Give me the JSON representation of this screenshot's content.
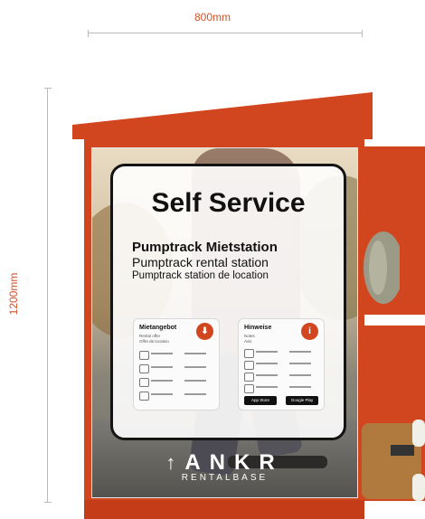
{
  "dimensions": {
    "width_label": "800mm",
    "height_label": "1200mm"
  },
  "sign": {
    "title": "Self Service",
    "subtitle_de": "Pumptrack Mietstation",
    "subtitle_en": "Pumptrack rental station",
    "subtitle_fr": "Pumptrack station de location",
    "rental_card": {
      "heading": "Mietangebot",
      "sub1": "Rental offer",
      "sub2": "Offre de location",
      "badge_icon": "pin-icon"
    },
    "info_card": {
      "heading": "Hinweise",
      "sub1": "Notes",
      "sub2": "Avis",
      "badge_icon": "info-icon",
      "store_apple": "App Store",
      "store_google": "Google Play"
    }
  },
  "logo": {
    "arrow": "↑",
    "name": "ANKR",
    "tagline": "RENTALBASE"
  },
  "colors": {
    "cabinet": "#d2461f",
    "dimension_text": "#d2532a"
  }
}
